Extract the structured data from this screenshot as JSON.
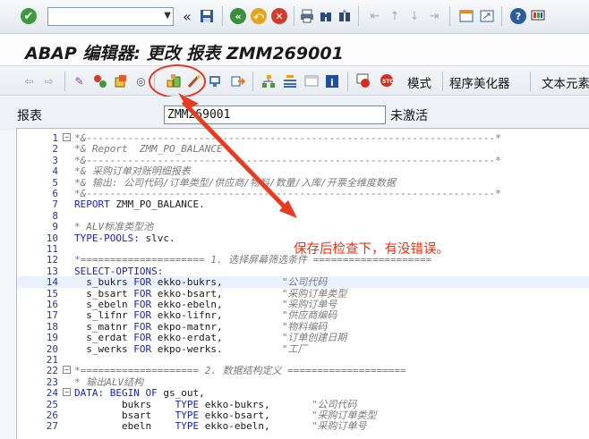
{
  "title": "ABAP 编辑器: 更改 报表 ZMM269001",
  "toolbar": {
    "buttons": [
      "模式",
      "程序美化器",
      "文本元素"
    ]
  },
  "field": {
    "label": "报表",
    "value": "ZMM269001",
    "status": "未激活"
  },
  "annotation": "保存后检查下，有没错误。",
  "code_lines": [
    {
      "n": "1",
      "fold": "⊟",
      "text": "*&---------------------------------------------------------------------*",
      "cls": "c-com"
    },
    {
      "n": "2",
      "fold": "",
      "text": "*& Report  ZMM_PO_BALANCE",
      "cls": "c-com"
    },
    {
      "n": "3",
      "fold": "",
      "text": "*&---------------------------------------------------------------------*",
      "cls": "c-com"
    },
    {
      "n": "4",
      "fold": "",
      "text": "*& 采购订单对账明细报表",
      "cls": "c-com"
    },
    {
      "n": "5",
      "fold": "",
      "text": "*& 输出: 公司代码/订单类型/供应商/物料/数量/入库/开票全维度数据",
      "cls": "c-com"
    },
    {
      "n": "6",
      "fold": "",
      "text": "*&---------------------------------------------------------------------*",
      "cls": "c-com"
    },
    {
      "n": "7",
      "fold": "",
      "text": "REPORT ZMM_PO_BALANCE.",
      "cls": "mixed-report"
    },
    {
      "n": "8",
      "fold": "",
      "text": "",
      "cls": "c-plain"
    },
    {
      "n": "9",
      "fold": "",
      "text": "* ALV标准类型池",
      "cls": "c-com"
    },
    {
      "n": "10",
      "fold": "",
      "text": "TYPE-POOLS: slvc.",
      "cls": "mixed-typepools"
    },
    {
      "n": "11",
      "fold": "",
      "text": "",
      "cls": "c-plain"
    },
    {
      "n": "12",
      "fold": "",
      "text": "*===================== 1. 选择屏幕筛选条件 ====================",
      "cls": "c-com"
    },
    {
      "n": "13",
      "fold": "",
      "text": "SELECT-OPTIONS:",
      "cls": "c-kw"
    },
    {
      "n": "14",
      "fold": "",
      "text": "  s_bukrs FOR ekko-bukrs,          \"公司代码",
      "cls": "so",
      "hl": true
    },
    {
      "n": "15",
      "fold": "",
      "text": "  s_bsart FOR ekko-bsart,          \"采购订单类型",
      "cls": "so"
    },
    {
      "n": "16",
      "fold": "",
      "text": "  s_ebeln FOR ekko-ebeln,          \"采购订单号",
      "cls": "so"
    },
    {
      "n": "17",
      "fold": "",
      "text": "  s_lifnr FOR ekko-lifnr,          \"供应商编码",
      "cls": "so"
    },
    {
      "n": "18",
      "fold": "",
      "text": "  s_matnr FOR ekpo-matnr,          \"物料编码",
      "cls": "so"
    },
    {
      "n": "19",
      "fold": "",
      "text": "  s_erdat FOR ekko-erdat,          \"订单创建日期",
      "cls": "so"
    },
    {
      "n": "20",
      "fold": "",
      "text": "  s_werks FOR ekpo-werks.          \"工厂",
      "cls": "so"
    },
    {
      "n": "21",
      "fold": "",
      "text": "",
      "cls": "c-plain"
    },
    {
      "n": "22",
      "fold": "⊟",
      "text": "*==================== 2. 数据结构定义 ====================",
      "cls": "c-com"
    },
    {
      "n": "23",
      "fold": "",
      "text": "* 输出ALV结构",
      "cls": "c-com"
    },
    {
      "n": "24",
      "fold": "⊟",
      "text": "DATA: BEGIN OF gs_out,",
      "cls": "data"
    },
    {
      "n": "25",
      "fold": "",
      "text": "        bukrs    TYPE ekko-bukrs,       \"公司代码",
      "cls": "typ"
    },
    {
      "n": "26",
      "fold": "",
      "text": "        bsart    TYPE ekko-bsart,       \"采购订单类型",
      "cls": "typ"
    },
    {
      "n": "27",
      "fold": "",
      "text": "        ebeln    TYPE ekko-ebeln,       \"采购订单号",
      "cls": "typ"
    }
  ]
}
